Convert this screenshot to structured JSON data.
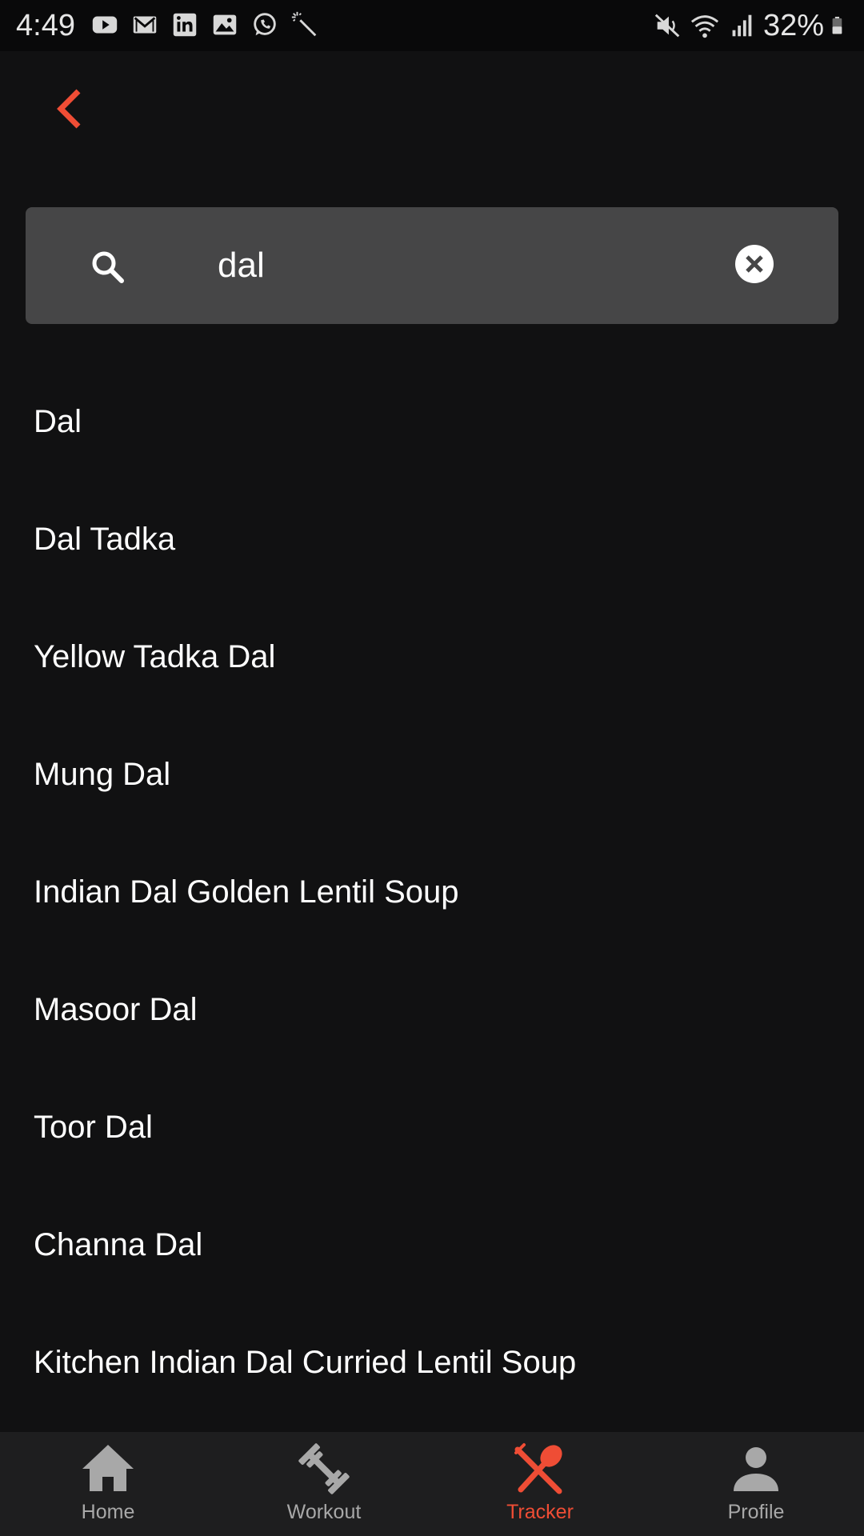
{
  "status_bar": {
    "time": "4:49",
    "battery_percent": "32%",
    "left_icons": [
      "youtube-icon",
      "gmail-icon",
      "linkedin-icon",
      "gallery-icon",
      "whatsapp-icon",
      "magic-wand-icon"
    ],
    "right_icons": [
      "mute-icon",
      "wifi-icon",
      "signal-icon",
      "battery-icon"
    ]
  },
  "header": {
    "back_icon": "chevron-left-icon"
  },
  "search": {
    "value": "dal",
    "placeholder": "",
    "search_icon": "search-icon",
    "clear_icon": "close-circle-icon"
  },
  "results": [
    {
      "label": "Dal"
    },
    {
      "label": "Dal Tadka"
    },
    {
      "label": "Yellow Tadka Dal"
    },
    {
      "label": "Mung Dal"
    },
    {
      "label": "Indian Dal Golden Lentil Soup"
    },
    {
      "label": "Masoor Dal"
    },
    {
      "label": "Toor Dal"
    },
    {
      "label": "Channa Dal"
    },
    {
      "label": "Kitchen Indian Dal Curried Lentil Soup"
    }
  ],
  "bottom_nav": {
    "active": "tracker",
    "tabs": [
      {
        "id": "home",
        "label": "Home",
        "icon": "home-icon"
      },
      {
        "id": "workout",
        "label": "Workout",
        "icon": "dumbbell-icon"
      },
      {
        "id": "tracker",
        "label": "Tracker",
        "icon": "fork-spoon-icon"
      },
      {
        "id": "profile",
        "label": "Profile",
        "icon": "person-icon"
      }
    ]
  },
  "colors": {
    "background": "#111112",
    "accent": "#ef4d35",
    "search_bg": "#464647",
    "nav_bg": "#1e1e1f",
    "nav_inactive": "#a8a8a8",
    "caret": "#4a7cf0"
  }
}
